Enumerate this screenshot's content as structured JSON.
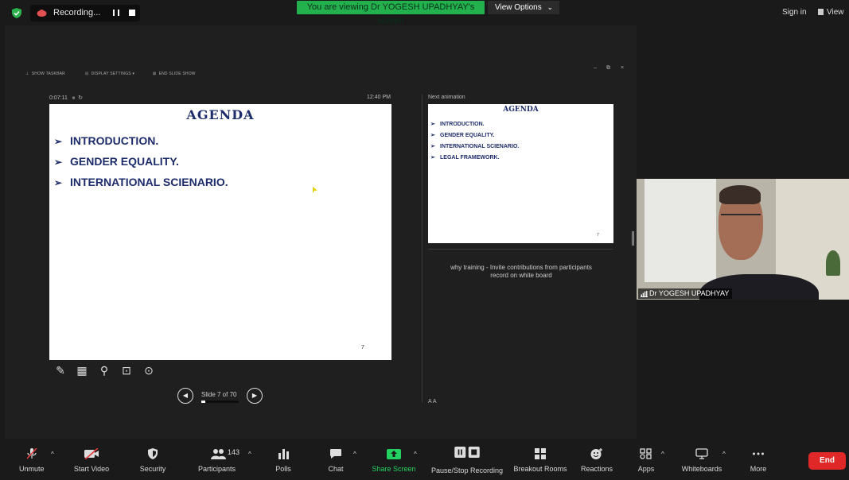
{
  "top_bar": {
    "recording_label": "Recording...",
    "viewing_banner": "You are viewing Dr YOGESH UPADHYAY's screen",
    "view_options_label": "View Options",
    "sign_in_label": "Sign in",
    "view_label": "View"
  },
  "presenter_toolbar": {
    "show_taskbar": "SHOW TASKBAR",
    "display_settings": "DISPLAY SETTINGS ▾",
    "end_slide_show": "END SLIDE SHOW",
    "minimize": "–",
    "restore": "⧉",
    "close": "×"
  },
  "presenter_view": {
    "elapsed_time": "0:07:11",
    "clock": "12:40 PM",
    "next_animation_label": "Next animation",
    "slide_title": "AGENDA",
    "slide_items": [
      "INTRODUCTION.",
      "GENDER EQUALITY.",
      "INTERNATIONAL SCIENARIO."
    ],
    "slide_page_number": "7",
    "slide_counter": "Slide 7 of 70",
    "slide_progress": 0.1,
    "next_title": "AGENDA",
    "next_items": [
      "INTRODUCTION.",
      "GENDER EQUALITY.",
      "INTERNATIONAL SCIENARIO.",
      "LEGAL FRAMEWORK."
    ],
    "next_page_number": "7",
    "notes_line1": "why training -  Invite contributions from participants",
    "notes_line2": "record on white board",
    "font_size_controls": "A  A"
  },
  "video_tile": {
    "name": "Dr YOGESH UPADHYAY"
  },
  "bottom_toolbar": {
    "unmute": "Unmute",
    "start_video": "Start Video",
    "security": "Security",
    "participants": "Participants",
    "participant_count": "143",
    "polls": "Polls",
    "chat": "Chat",
    "share_screen": "Share Screen",
    "pause_stop_recording": "Pause/Stop Recording",
    "breakout_rooms": "Breakout Rooms",
    "reactions": "Reactions",
    "apps": "Apps",
    "whiteboards": "Whiteboards",
    "more": "More",
    "end": "End"
  },
  "colors": {
    "banner_green": "#22b14c",
    "end_red": "#e02828",
    "slide_text_navy": "#1d2c6b"
  }
}
